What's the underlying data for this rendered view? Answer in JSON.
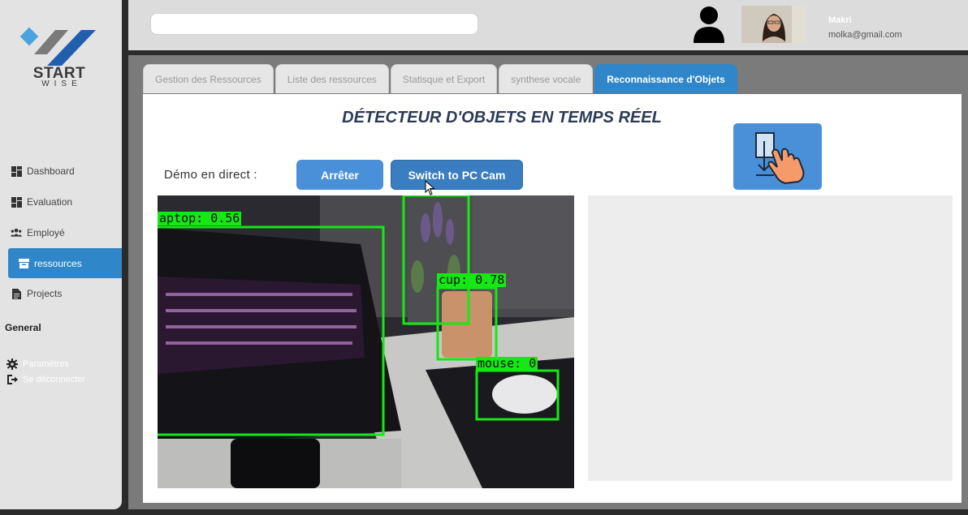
{
  "brand": {
    "name": "START",
    "tagline": "WISE"
  },
  "sidebar": {
    "items": [
      {
        "label": "Dashboard",
        "icon": "dashboard-icon"
      },
      {
        "label": "Evaluation",
        "icon": "dashboard-icon"
      },
      {
        "label": "Employé",
        "icon": "users-icon"
      },
      {
        "label": "ressources",
        "icon": "archive-icon",
        "active": true
      },
      {
        "label": "Projects",
        "icon": "document-icon"
      }
    ],
    "section_general": "General",
    "settings_label": "Paramètres",
    "logout_label": "Se déconnecter"
  },
  "header": {
    "search_placeholder": "",
    "user_name": "Makri",
    "user_email": "molka@gmail.com"
  },
  "tabs": [
    {
      "label": "Gestion des Ressources",
      "active": false
    },
    {
      "label": "Liste des ressources",
      "active": false
    },
    {
      "label": "Statisque et Export",
      "active": false
    },
    {
      "label": "synthese vocale",
      "active": false
    },
    {
      "label": "Reconnaissance d'Objets",
      "active": true
    }
  ],
  "main": {
    "title": "DÉTECTEUR D'OBJETS EN TEMPS RÉEL",
    "demo_label": "Démo en direct :",
    "stop_button": "Arrêter",
    "switch_button": "Switch to PC Cam",
    "hand_icon": "hand-touch-download-icon"
  },
  "detections": [
    {
      "label": "aptop: 0.56",
      "object": "laptop",
      "confidence": 0.56
    },
    {
      "label": "cup: 0.78",
      "object": "cup",
      "confidence": 0.78
    },
    {
      "label": "mouse: 0",
      "object": "mouse"
    }
  ],
  "colors": {
    "accent": "#2f86c9",
    "button": "#4a90d9",
    "detection_box": "#15e815",
    "title": "#2b3a55"
  }
}
